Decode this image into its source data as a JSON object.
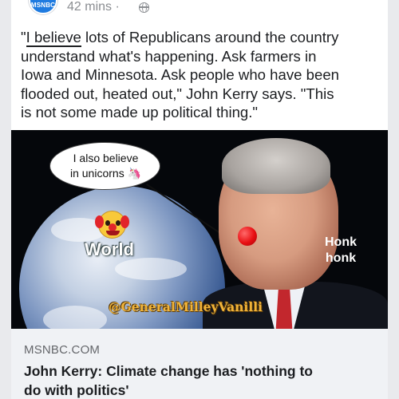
{
  "post": {
    "page_name_logo": "MSNBC",
    "time": "42 mins ·",
    "text_lines": [
      {
        "pre": "\"",
        "underlined": "I believe",
        "post": " lots of Republicans around the country"
      },
      "understand what's happening. Ask farmers in",
      "Iowa and Minnesota. Ask people who have been",
      "flooded out, heated out,\" John Kerry says. \"This",
      "is not some made up political thing.\""
    ]
  },
  "image": {
    "speech_bubble_lines": [
      "I also believe",
      "in unicorns 🦄"
    ],
    "world_label": "World",
    "honk_lines": [
      "Honk",
      "honk"
    ],
    "watermark": "@GeneralMilleyVanilli"
  },
  "link_preview": {
    "domain": "MSNBC.COM",
    "title_lines": [
      "John Kerry: Climate change has 'nothing to",
      "do with politics'"
    ]
  },
  "icons": {
    "audience": "globe-icon",
    "world_emoji": "clown-face-icon"
  },
  "colors": {
    "accent": "#1f7be0",
    "clown_nose": "#e80e12",
    "watermark": "#f1b43a"
  }
}
